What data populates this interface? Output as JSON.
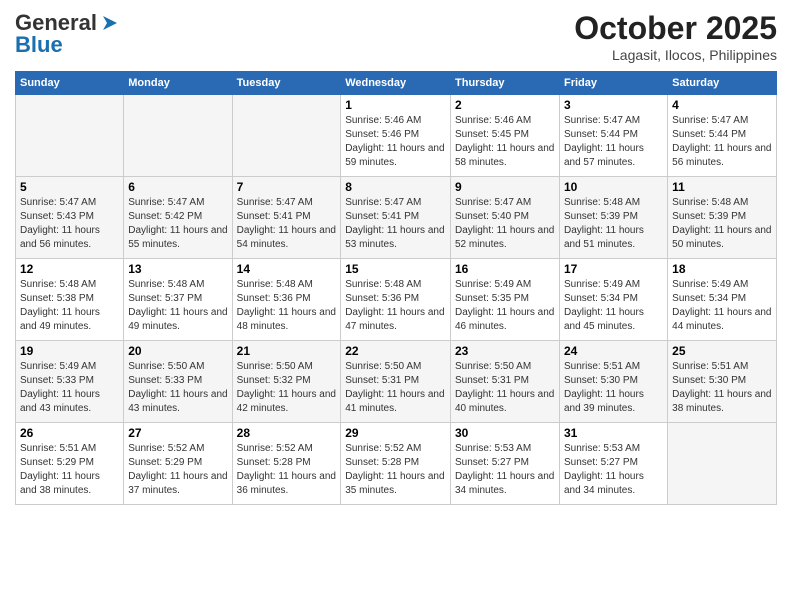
{
  "header": {
    "logo_line1": "General",
    "logo_line2": "Blue",
    "month": "October 2025",
    "location": "Lagasit, Ilocos, Philippines"
  },
  "weekdays": [
    "Sunday",
    "Monday",
    "Tuesday",
    "Wednesday",
    "Thursday",
    "Friday",
    "Saturday"
  ],
  "weeks": [
    [
      {
        "day": "",
        "info": ""
      },
      {
        "day": "",
        "info": ""
      },
      {
        "day": "",
        "info": ""
      },
      {
        "day": "1",
        "info": "Sunrise: 5:46 AM\nSunset: 5:46 PM\nDaylight: 11 hours and 59 minutes."
      },
      {
        "day": "2",
        "info": "Sunrise: 5:46 AM\nSunset: 5:45 PM\nDaylight: 11 hours and 58 minutes."
      },
      {
        "day": "3",
        "info": "Sunrise: 5:47 AM\nSunset: 5:44 PM\nDaylight: 11 hours and 57 minutes."
      },
      {
        "day": "4",
        "info": "Sunrise: 5:47 AM\nSunset: 5:44 PM\nDaylight: 11 hours and 56 minutes."
      }
    ],
    [
      {
        "day": "5",
        "info": "Sunrise: 5:47 AM\nSunset: 5:43 PM\nDaylight: 11 hours and 56 minutes."
      },
      {
        "day": "6",
        "info": "Sunrise: 5:47 AM\nSunset: 5:42 PM\nDaylight: 11 hours and 55 minutes."
      },
      {
        "day": "7",
        "info": "Sunrise: 5:47 AM\nSunset: 5:41 PM\nDaylight: 11 hours and 54 minutes."
      },
      {
        "day": "8",
        "info": "Sunrise: 5:47 AM\nSunset: 5:41 PM\nDaylight: 11 hours and 53 minutes."
      },
      {
        "day": "9",
        "info": "Sunrise: 5:47 AM\nSunset: 5:40 PM\nDaylight: 11 hours and 52 minutes."
      },
      {
        "day": "10",
        "info": "Sunrise: 5:48 AM\nSunset: 5:39 PM\nDaylight: 11 hours and 51 minutes."
      },
      {
        "day": "11",
        "info": "Sunrise: 5:48 AM\nSunset: 5:39 PM\nDaylight: 11 hours and 50 minutes."
      }
    ],
    [
      {
        "day": "12",
        "info": "Sunrise: 5:48 AM\nSunset: 5:38 PM\nDaylight: 11 hours and 49 minutes."
      },
      {
        "day": "13",
        "info": "Sunrise: 5:48 AM\nSunset: 5:37 PM\nDaylight: 11 hours and 49 minutes."
      },
      {
        "day": "14",
        "info": "Sunrise: 5:48 AM\nSunset: 5:36 PM\nDaylight: 11 hours and 48 minutes."
      },
      {
        "day": "15",
        "info": "Sunrise: 5:48 AM\nSunset: 5:36 PM\nDaylight: 11 hours and 47 minutes."
      },
      {
        "day": "16",
        "info": "Sunrise: 5:49 AM\nSunset: 5:35 PM\nDaylight: 11 hours and 46 minutes."
      },
      {
        "day": "17",
        "info": "Sunrise: 5:49 AM\nSunset: 5:34 PM\nDaylight: 11 hours and 45 minutes."
      },
      {
        "day": "18",
        "info": "Sunrise: 5:49 AM\nSunset: 5:34 PM\nDaylight: 11 hours and 44 minutes."
      }
    ],
    [
      {
        "day": "19",
        "info": "Sunrise: 5:49 AM\nSunset: 5:33 PM\nDaylight: 11 hours and 43 minutes."
      },
      {
        "day": "20",
        "info": "Sunrise: 5:50 AM\nSunset: 5:33 PM\nDaylight: 11 hours and 43 minutes."
      },
      {
        "day": "21",
        "info": "Sunrise: 5:50 AM\nSunset: 5:32 PM\nDaylight: 11 hours and 42 minutes."
      },
      {
        "day": "22",
        "info": "Sunrise: 5:50 AM\nSunset: 5:31 PM\nDaylight: 11 hours and 41 minutes."
      },
      {
        "day": "23",
        "info": "Sunrise: 5:50 AM\nSunset: 5:31 PM\nDaylight: 11 hours and 40 minutes."
      },
      {
        "day": "24",
        "info": "Sunrise: 5:51 AM\nSunset: 5:30 PM\nDaylight: 11 hours and 39 minutes."
      },
      {
        "day": "25",
        "info": "Sunrise: 5:51 AM\nSunset: 5:30 PM\nDaylight: 11 hours and 38 minutes."
      }
    ],
    [
      {
        "day": "26",
        "info": "Sunrise: 5:51 AM\nSunset: 5:29 PM\nDaylight: 11 hours and 38 minutes."
      },
      {
        "day": "27",
        "info": "Sunrise: 5:52 AM\nSunset: 5:29 PM\nDaylight: 11 hours and 37 minutes."
      },
      {
        "day": "28",
        "info": "Sunrise: 5:52 AM\nSunset: 5:28 PM\nDaylight: 11 hours and 36 minutes."
      },
      {
        "day": "29",
        "info": "Sunrise: 5:52 AM\nSunset: 5:28 PM\nDaylight: 11 hours and 35 minutes."
      },
      {
        "day": "30",
        "info": "Sunrise: 5:53 AM\nSunset: 5:27 PM\nDaylight: 11 hours and 34 minutes."
      },
      {
        "day": "31",
        "info": "Sunrise: 5:53 AM\nSunset: 5:27 PM\nDaylight: 11 hours and 34 minutes."
      },
      {
        "day": "",
        "info": ""
      }
    ]
  ]
}
